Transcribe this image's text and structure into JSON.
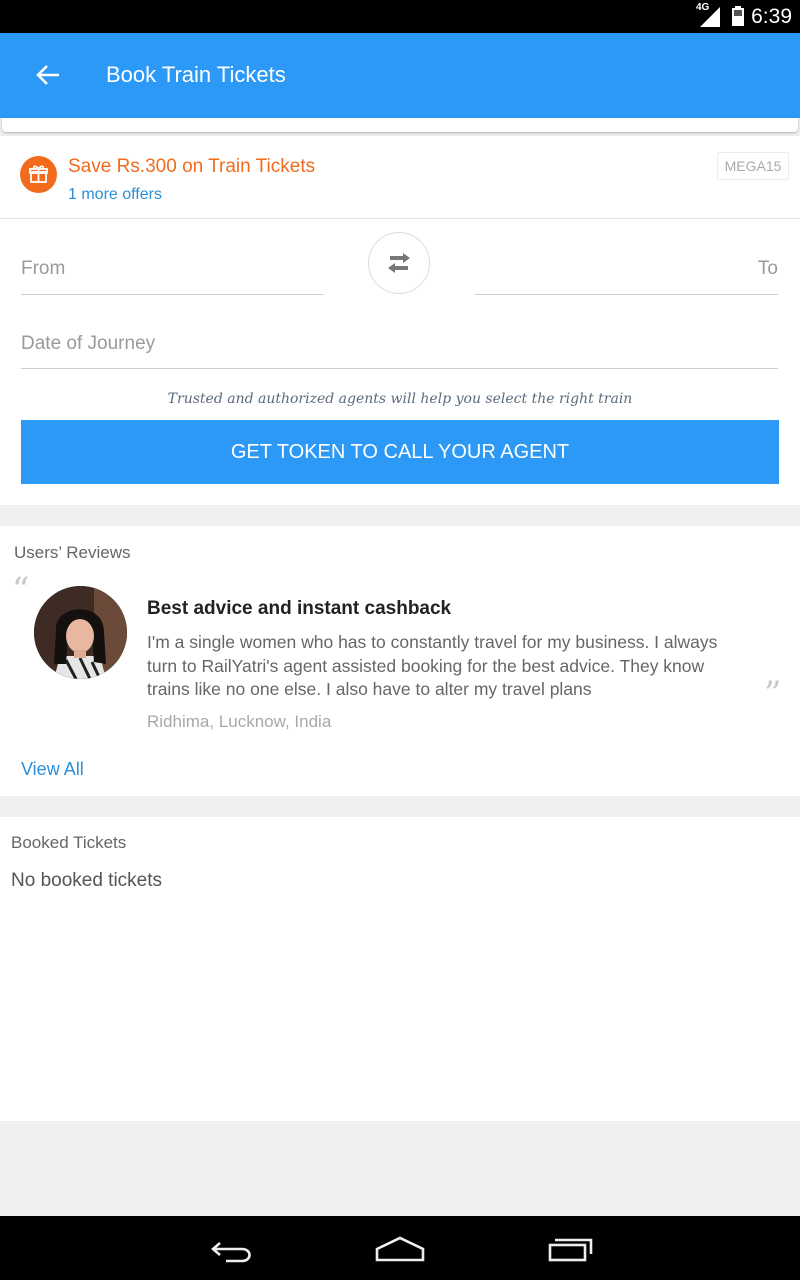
{
  "status_bar": {
    "network_label": "4G",
    "time": "6:39",
    "icons": [
      "signal-icon",
      "battery-icon"
    ]
  },
  "app_bar": {
    "title": "Book Train Tickets",
    "back_icon": "arrow-left-icon",
    "color": "#2b99f5"
  },
  "offer": {
    "icon": "gift-icon",
    "title": "Save Rs.300 on Train Tickets",
    "more_link": "1 more offers",
    "code": "MEGA15",
    "accent_color": "#f26b1d"
  },
  "booking_form": {
    "from_placeholder": "From",
    "to_placeholder": "To",
    "swap_icon": "swap-arrows-icon",
    "date_placeholder": "Date of Journey",
    "trust_note": "Trusted and authorized agents will help you select the right train",
    "cta_label": "GET TOKEN TO CALL YOUR AGENT"
  },
  "reviews": {
    "heading": "Users’ Reviews",
    "open_quote": "“",
    "close_quote": "”",
    "items": [
      {
        "title": "Best advice and instant cashback",
        "body": "I'm a single women who has to constantly travel for my business. I always turn to RailYatri's agent assisted booking for the best advice. They know trains like no one else. I also have to alter my travel plans",
        "author": "Ridhima, Lucknow, India"
      }
    ],
    "view_all_label": "View All"
  },
  "booked_tickets": {
    "heading": "Booked Tickets",
    "empty_message": "No booked tickets"
  },
  "nav_bar": {
    "icons": [
      "back-nav-icon",
      "home-nav-icon",
      "recents-nav-icon"
    ]
  }
}
